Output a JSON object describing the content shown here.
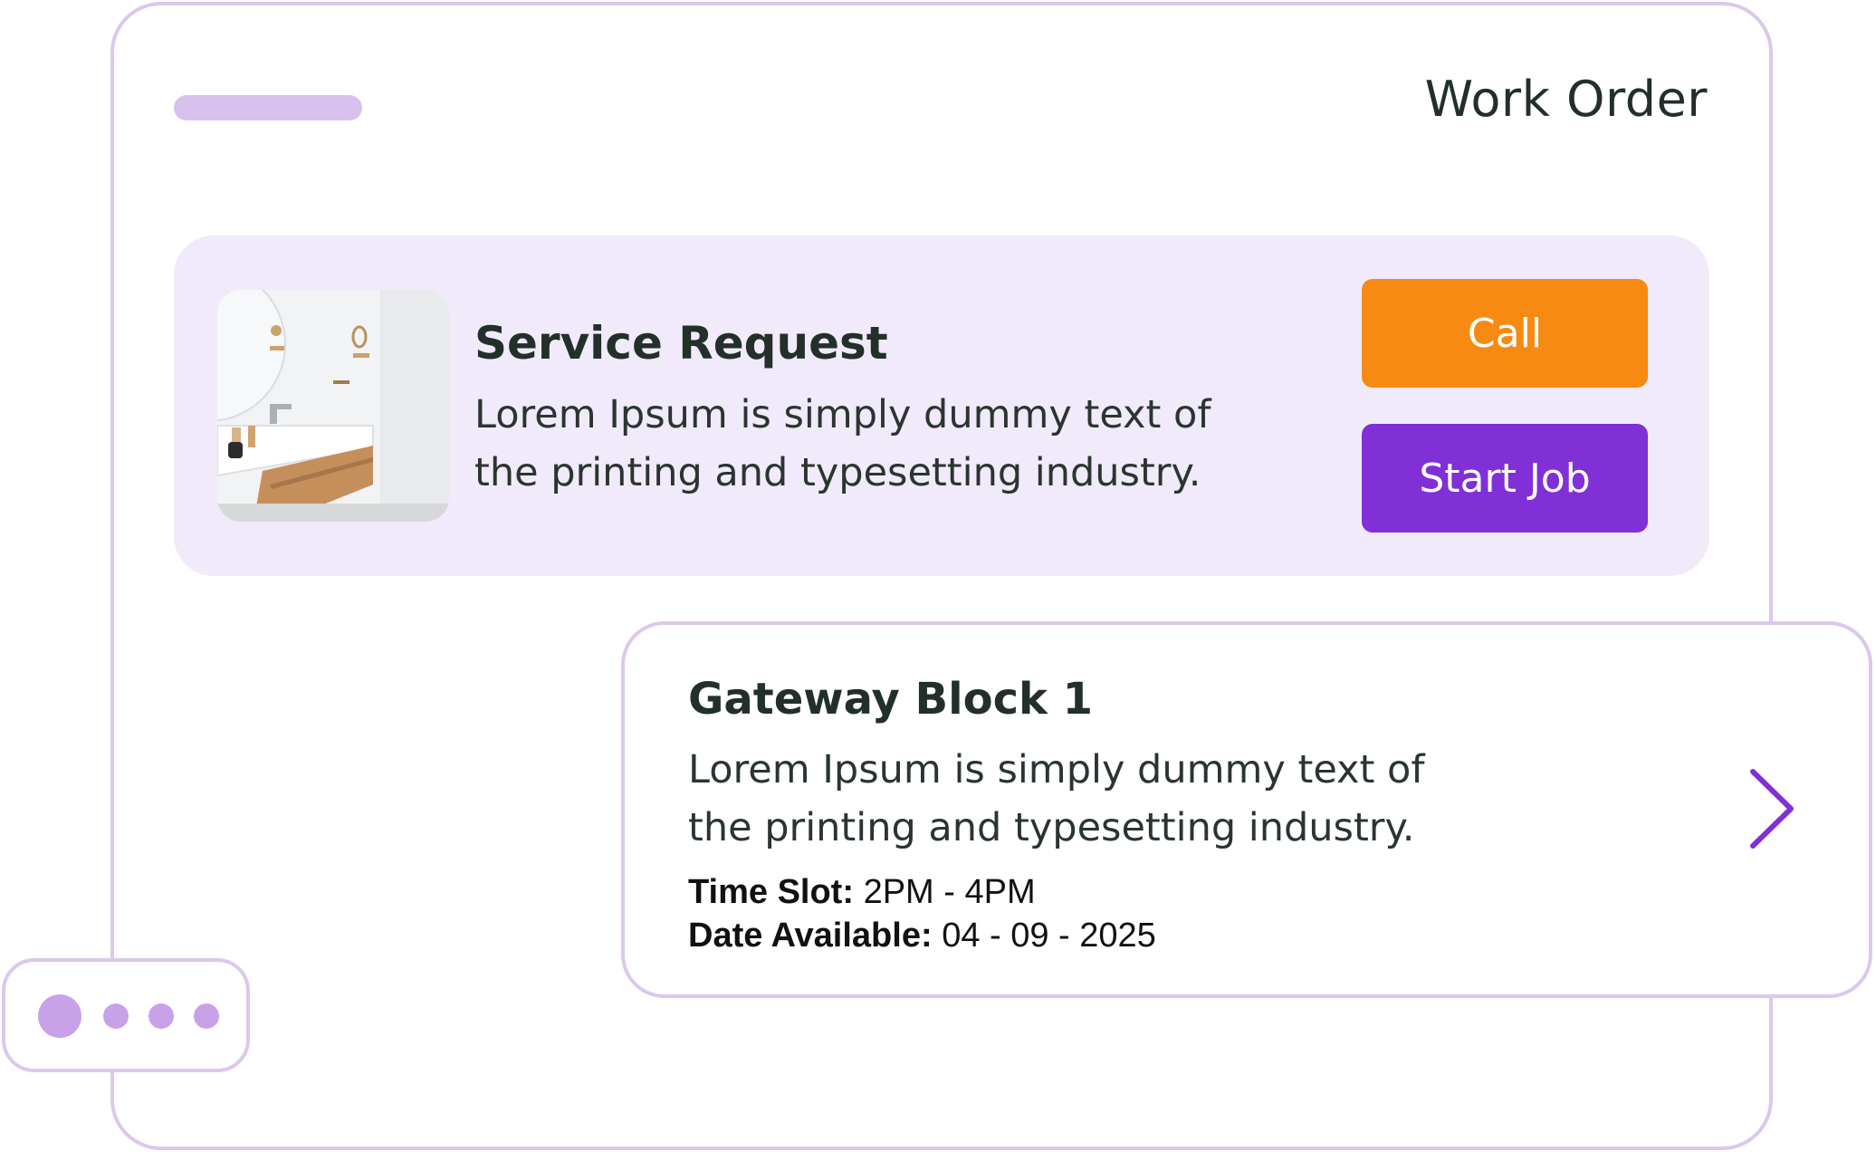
{
  "window": {
    "title": "Work Order"
  },
  "service_request": {
    "title": "Service Request",
    "description": "Lorem Ipsum is simply dummy text of the printing and typesetting industry.",
    "image": "bathroom-photo",
    "call_label": "Call",
    "start_label": "Start Job"
  },
  "block": {
    "title": "Gateway Block 1",
    "description": "Lorem Ipsum is simply dummy text of the printing and typesetting industry.",
    "time_slot_label": "Time Slot:",
    "time_slot_value": "2PM - 4PM",
    "date_label": "Date Available:",
    "date_value": "04 - 09 - 2025",
    "arrow_icon": "chevron-right-icon"
  },
  "colors": {
    "accent_orange": "#f78a13",
    "accent_purple": "#812fd7",
    "border_lilac": "#dcc8ec",
    "card_bg": "#f1eafa",
    "dot": "#c9a1e9"
  }
}
